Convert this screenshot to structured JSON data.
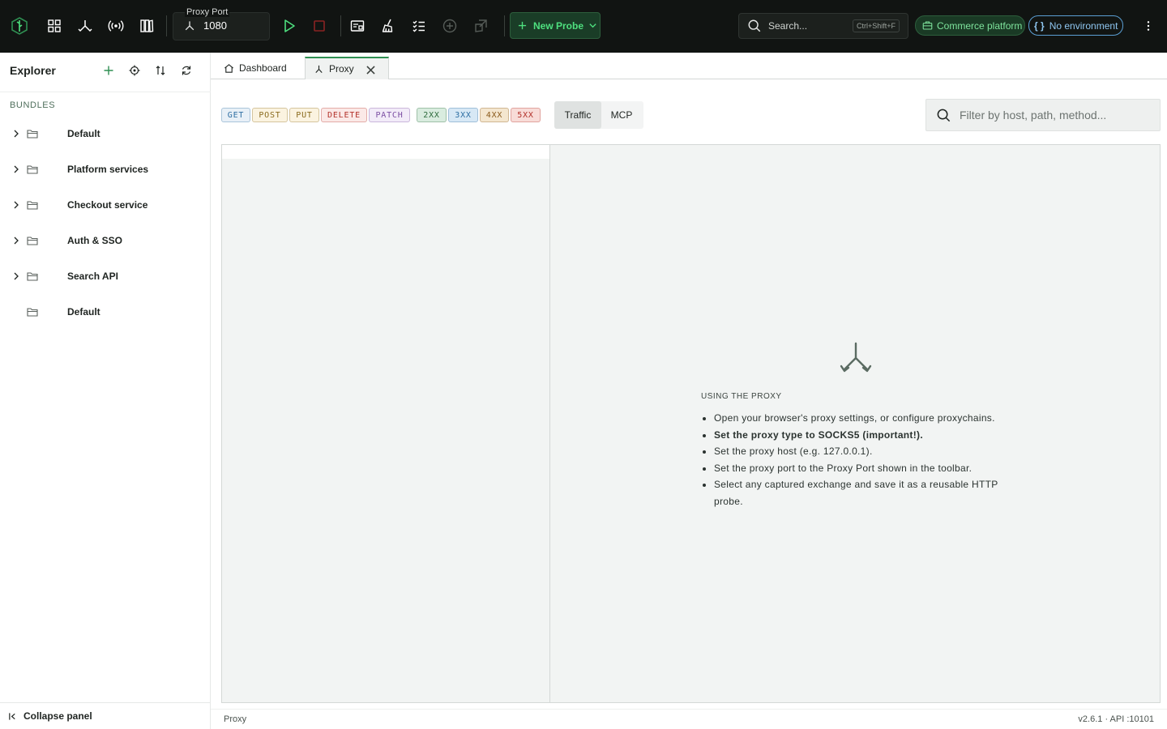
{
  "topbar": {
    "proxy_port_label": "Proxy Port",
    "proxy_port_value": "1080",
    "new_probe_label": "New Probe",
    "search_placeholder": "Search...",
    "search_shortcut": "Ctrl+Shift+F",
    "workspace": "Commerce platform",
    "environment_braces": "{ }",
    "environment": "No environment",
    "brand_color": "#4ee07f",
    "env_color": "#8fc6f0",
    "icons": [
      "logo-icon",
      "grid-icon",
      "proxy-fork-icon",
      "broadcast-icon",
      "library-icon",
      "play-icon",
      "stop-icon",
      "inbox-card-icon",
      "broom-icon",
      "checklist-icon",
      "add-circle-icon",
      "export-icon",
      "more-icon"
    ]
  },
  "sidebar": {
    "title": "Explorer",
    "section_label": "BUNDLES",
    "items": [
      {
        "label": "Default",
        "expandable": true
      },
      {
        "label": "Platform services",
        "expandable": true
      },
      {
        "label": "Checkout service",
        "expandable": true
      },
      {
        "label": "Auth & SSO",
        "expandable": true
      },
      {
        "label": "Search API",
        "expandable": true
      },
      {
        "label": "Default",
        "expandable": false
      }
    ],
    "collapse_label": "Collapse panel"
  },
  "tabs": [
    {
      "label": "Dashboard",
      "active": false
    },
    {
      "label": "Proxy",
      "active": true
    }
  ],
  "filters": {
    "methods": [
      {
        "label": "GET",
        "color": "#2f6fa3",
        "bg": "#e8f0f7"
      },
      {
        "label": "POST",
        "color": "#8a6a1c",
        "bg": "#fbf3e0"
      },
      {
        "label": "PUT",
        "color": "#8a6a1c",
        "bg": "#fbf3e0"
      },
      {
        "label": "DELETE",
        "color": "#b3322b",
        "bg": "#fbe9e7"
      },
      {
        "label": "PATCH",
        "color": "#7c4fa3",
        "bg": "#f2ebf8"
      }
    ],
    "statuses": [
      {
        "label": "2XX",
        "color": "#2d6b3c",
        "bg": "#d9ecdf"
      },
      {
        "label": "3XX",
        "color": "#2f6fa3",
        "bg": "#d7e8f5"
      },
      {
        "label": "4XX",
        "color": "#8a5a1c",
        "bg": "#f4e6cf"
      },
      {
        "label": "5XX",
        "color": "#b3322b",
        "bg": "#f8dcd8"
      }
    ],
    "views": [
      {
        "label": "Traffic",
        "active": true
      },
      {
        "label": "MCP",
        "active": false
      }
    ],
    "filter_placeholder": "Filter by host, path, method..."
  },
  "empty_state": {
    "title": "USING THE PROXY",
    "steps": [
      {
        "text": "Open your browser's proxy settings, or configure proxychains.",
        "bold": false
      },
      {
        "text": "Set the proxy type to SOCKS5 (important!).",
        "bold": true
      },
      {
        "text": "Set the proxy host (e.g. 127.0.0.1).",
        "bold": false
      },
      {
        "text": "Set the proxy port to the Proxy Port shown in the toolbar.",
        "bold": false
      },
      {
        "text": "Select any captured exchange and save it as a reusable HTTP probe.",
        "bold": false
      }
    ]
  },
  "statusbar": {
    "left": "Proxy",
    "right": "v2.6.1  · API :10101"
  }
}
